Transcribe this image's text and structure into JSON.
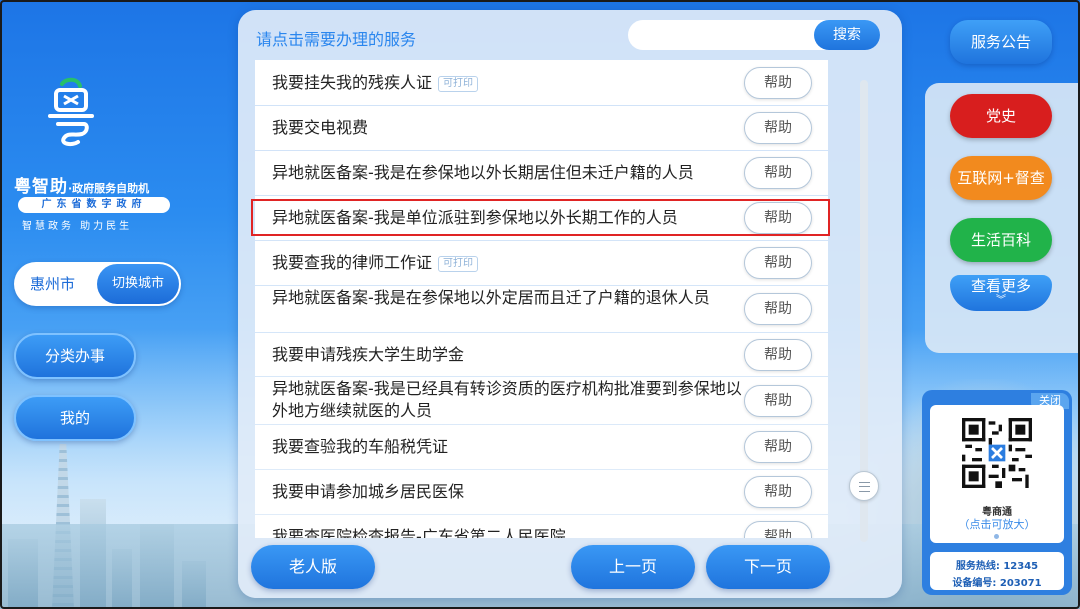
{
  "brand": {
    "name": "粤智助",
    "subtitle": "·政府服务自助机",
    "tag": "广东省数字政府",
    "slogan": "智慧政务  助力民生"
  },
  "city": {
    "name": "惠州市",
    "switch_label": "切换城市"
  },
  "left_menu": {
    "category": "分类办事",
    "mine": "我的"
  },
  "main": {
    "title": "请点击需要办理的服务",
    "search_placeholder": "",
    "search_label": "搜索",
    "help_label": "帮助",
    "services": [
      {
        "text": "我要挂失我的残疾人证",
        "tag": "可打印"
      },
      {
        "text": "我要交电视费",
        "tag": ""
      },
      {
        "text": "异地就医备案-我是在参保地以外长期居住但未迁户籍的人员",
        "tag": ""
      },
      {
        "text": "异地就医备案-我是单位派驻到参保地以外长期工作的人员",
        "tag": "",
        "highlighted": true
      },
      {
        "text": "我要查我的律师工作证",
        "tag": "可打印"
      },
      {
        "text": "异地就医备案-我是在参保地以外定居而且迁了户籍的退休人员",
        "tag": ""
      },
      {
        "text": "我要申请残疾大学生助学金",
        "tag": ""
      },
      {
        "text": "异地就医备案-我是已经具有转诊资质的医疗机构批准要到参保地以外地方继续就医的人员",
        "tag": ""
      },
      {
        "text": "我要查验我的车船税凭证",
        "tag": ""
      },
      {
        "text": "我要申请参加城乡居民医保",
        "tag": ""
      },
      {
        "text": "我要查医院检查报告-广东省第二人民医院",
        "tag": ""
      }
    ],
    "elder_label": "老人版",
    "prev_label": "上一页",
    "next_label": "下一页"
  },
  "right": {
    "notice_label": "服务公告",
    "party_history_label": "党史",
    "supervision_label": "互联网+督查",
    "life_wiki_label": "生活百科",
    "more_label": "查看更多",
    "more_icon": "double-chevron-down-icon",
    "colors": {
      "party": "#d81e1e",
      "supervision": "#f28a1e",
      "life": "#21b34a"
    }
  },
  "qr": {
    "close_label": "关闭",
    "app_name": "粤商通",
    "hint": "（点击可放大）",
    "hotline": "服务热线: 12345",
    "device": "设备编号: 203071"
  }
}
